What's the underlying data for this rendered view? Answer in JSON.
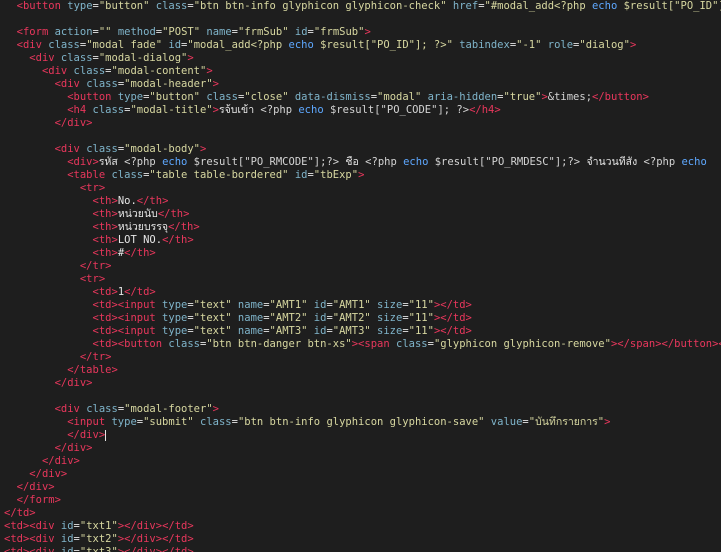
{
  "lines": [
    [
      [
        "  ",
        "t-txt"
      ],
      [
        "<button",
        "t-tag"
      ],
      [
        " type",
        "t-attr"
      ],
      [
        "=",
        "t-txt"
      ],
      [
        "\"button\"",
        "t-str"
      ],
      [
        " class",
        "t-attr"
      ],
      [
        "=",
        "t-txt"
      ],
      [
        "\"btn btn-info glyphicon glyphicon-check\"",
        "t-str"
      ],
      [
        " href",
        "t-attr"
      ],
      [
        "=",
        "t-txt"
      ],
      [
        "\"#modal_add<?php ",
        "t-str"
      ],
      [
        "echo",
        "t-kw"
      ],
      [
        " $result[\"PO_ID\"]; ?>\"",
        "t-str"
      ]
    ],
    [
      [
        "",
        "t-txt"
      ]
    ],
    [
      [
        "  ",
        "t-txt"
      ],
      [
        "<form",
        "t-tag"
      ],
      [
        " action",
        "t-attr"
      ],
      [
        "=",
        "t-txt"
      ],
      [
        "\"\"",
        "t-str"
      ],
      [
        " method",
        "t-attr"
      ],
      [
        "=",
        "t-txt"
      ],
      [
        "\"POST\"",
        "t-str"
      ],
      [
        " name",
        "t-attr"
      ],
      [
        "=",
        "t-txt"
      ],
      [
        "\"frmSub\"",
        "t-str"
      ],
      [
        " id",
        "t-attr"
      ],
      [
        "=",
        "t-txt"
      ],
      [
        "\"frmSub\"",
        "t-str"
      ],
      [
        ">",
        "t-tag"
      ]
    ],
    [
      [
        "  ",
        "t-txt"
      ],
      [
        "<div",
        "t-tag"
      ],
      [
        " class",
        "t-attr"
      ],
      [
        "=",
        "t-txt"
      ],
      [
        "\"modal fade\"",
        "t-str"
      ],
      [
        " id",
        "t-attr"
      ],
      [
        "=",
        "t-txt"
      ],
      [
        "\"modal_add<?php ",
        "t-str"
      ],
      [
        "echo",
        "t-kw"
      ],
      [
        " $result[\"PO_ID\"]; ?>\"",
        "t-str"
      ],
      [
        " tabindex",
        "t-attr"
      ],
      [
        "=",
        "t-txt"
      ],
      [
        "\"-1\"",
        "t-str"
      ],
      [
        " role",
        "t-attr"
      ],
      [
        "=",
        "t-txt"
      ],
      [
        "\"dialog\"",
        "t-str"
      ],
      [
        ">",
        "t-tag"
      ]
    ],
    [
      [
        "    ",
        "t-txt"
      ],
      [
        "<div",
        "t-tag"
      ],
      [
        " class",
        "t-attr"
      ],
      [
        "=",
        "t-txt"
      ],
      [
        "\"modal-dialog\"",
        "t-str"
      ],
      [
        ">",
        "t-tag"
      ]
    ],
    [
      [
        "      ",
        "t-txt"
      ],
      [
        "<div",
        "t-tag"
      ],
      [
        " class",
        "t-attr"
      ],
      [
        "=",
        "t-txt"
      ],
      [
        "\"modal-content\"",
        "t-str"
      ],
      [
        ">",
        "t-tag"
      ]
    ],
    [
      [
        "        ",
        "t-txt"
      ],
      [
        "<div",
        "t-tag"
      ],
      [
        " class",
        "t-attr"
      ],
      [
        "=",
        "t-txt"
      ],
      [
        "\"modal-header\"",
        "t-str"
      ],
      [
        ">",
        "t-tag"
      ]
    ],
    [
      [
        "          ",
        "t-txt"
      ],
      [
        "<button",
        "t-tag"
      ],
      [
        " type",
        "t-attr"
      ],
      [
        "=",
        "t-txt"
      ],
      [
        "\"button\"",
        "t-str"
      ],
      [
        " class",
        "t-attr"
      ],
      [
        "=",
        "t-txt"
      ],
      [
        "\"close\"",
        "t-str"
      ],
      [
        " data-dismiss",
        "t-attr"
      ],
      [
        "=",
        "t-txt"
      ],
      [
        "\"modal\"",
        "t-str"
      ],
      [
        " aria-hidden",
        "t-attr"
      ],
      [
        "=",
        "t-txt"
      ],
      [
        "\"true\"",
        "t-str"
      ],
      [
        ">",
        "t-tag"
      ],
      [
        "&times;",
        "t-ent"
      ],
      [
        "</button>",
        "t-tag"
      ]
    ],
    [
      [
        "          ",
        "t-txt"
      ],
      [
        "<h4",
        "t-tag"
      ],
      [
        " class",
        "t-attr"
      ],
      [
        "=",
        "t-txt"
      ],
      [
        "\"modal-title\"",
        "t-str"
      ],
      [
        ">",
        "t-tag"
      ],
      [
        "รจ้บเข้า ",
        "t-txt"
      ],
      [
        "<?php ",
        "t-php"
      ],
      [
        "echo",
        "t-kw"
      ],
      [
        " $result[\"PO_CODE\"]; ?>",
        "t-php"
      ],
      [
        "</h4>",
        "t-tag"
      ]
    ],
    [
      [
        "        ",
        "t-txt"
      ],
      [
        "</div>",
        "t-tag"
      ]
    ],
    [
      [
        "",
        "t-txt"
      ]
    ],
    [
      [
        "        ",
        "t-txt"
      ],
      [
        "<div",
        "t-tag"
      ],
      [
        " class",
        "t-attr"
      ],
      [
        "=",
        "t-txt"
      ],
      [
        "\"modal-body\"",
        "t-str"
      ],
      [
        ">",
        "t-tag"
      ]
    ],
    [
      [
        "          ",
        "t-txt"
      ],
      [
        "<div>",
        "t-tag"
      ],
      [
        "รหัส ",
        "t-txt"
      ],
      [
        "<?php ",
        "t-php"
      ],
      [
        "echo",
        "t-kw"
      ],
      [
        " $result[\"PO_RMCODE\"];?> ",
        "t-php"
      ],
      [
        "ชื่อ ",
        "t-txt"
      ],
      [
        "<?php ",
        "t-php"
      ],
      [
        "echo",
        "t-kw"
      ],
      [
        " $result[\"PO_RMDESC\"];?> ",
        "t-php"
      ],
      [
        "จำนวนที่สั่ง ",
        "t-txt"
      ],
      [
        "<?php ",
        "t-php"
      ],
      [
        "echo",
        "t-kw"
      ]
    ],
    [
      [
        "          ",
        "t-txt"
      ],
      [
        "<table",
        "t-tag"
      ],
      [
        " class",
        "t-attr"
      ],
      [
        "=",
        "t-txt"
      ],
      [
        "\"table table-bordered\"",
        "t-str"
      ],
      [
        " id",
        "t-attr"
      ],
      [
        "=",
        "t-txt"
      ],
      [
        "\"tbExp\"",
        "t-str"
      ],
      [
        ">",
        "t-tag"
      ]
    ],
    [
      [
        "            ",
        "t-txt"
      ],
      [
        "<tr>",
        "t-tag"
      ]
    ],
    [
      [
        "              ",
        "t-txt"
      ],
      [
        "<th>",
        "t-tag"
      ],
      [
        "No.",
        "t-txt"
      ],
      [
        "</th>",
        "t-tag"
      ]
    ],
    [
      [
        "              ",
        "t-txt"
      ],
      [
        "<th>",
        "t-tag"
      ],
      [
        "หน่วยนับ",
        "t-txt"
      ],
      [
        "</th>",
        "t-tag"
      ]
    ],
    [
      [
        "              ",
        "t-txt"
      ],
      [
        "<th>",
        "t-tag"
      ],
      [
        "หน่วยบรรจุ",
        "t-txt"
      ],
      [
        "</th>",
        "t-tag"
      ]
    ],
    [
      [
        "              ",
        "t-txt"
      ],
      [
        "<th>",
        "t-tag"
      ],
      [
        "LOT NO.",
        "t-txt"
      ],
      [
        "</th>",
        "t-tag"
      ]
    ],
    [
      [
        "              ",
        "t-txt"
      ],
      [
        "<th>",
        "t-tag"
      ],
      [
        "#",
        "t-txt"
      ],
      [
        "</th>",
        "t-tag"
      ]
    ],
    [
      [
        "            ",
        "t-txt"
      ],
      [
        "</tr>",
        "t-tag"
      ]
    ],
    [
      [
        "            ",
        "t-txt"
      ],
      [
        "<tr>",
        "t-tag"
      ]
    ],
    [
      [
        "              ",
        "t-txt"
      ],
      [
        "<td>",
        "t-tag"
      ],
      [
        "1",
        "t-txt"
      ],
      [
        "</td>",
        "t-tag"
      ]
    ],
    [
      [
        "              ",
        "t-txt"
      ],
      [
        "<td><input",
        "t-tag"
      ],
      [
        " type",
        "t-attr"
      ],
      [
        "=",
        "t-txt"
      ],
      [
        "\"text\"",
        "t-str"
      ],
      [
        " name",
        "t-attr"
      ],
      [
        "=",
        "t-txt"
      ],
      [
        "\"AMT1\"",
        "t-str"
      ],
      [
        " id",
        "t-attr"
      ],
      [
        "=",
        "t-txt"
      ],
      [
        "\"AMT1\"",
        "t-str"
      ],
      [
        " size",
        "t-attr"
      ],
      [
        "=",
        "t-txt"
      ],
      [
        "\"11\"",
        "t-str"
      ],
      [
        "></td>",
        "t-tag"
      ]
    ],
    [
      [
        "              ",
        "t-txt"
      ],
      [
        "<td><input",
        "t-tag"
      ],
      [
        " type",
        "t-attr"
      ],
      [
        "=",
        "t-txt"
      ],
      [
        "\"text\"",
        "t-str"
      ],
      [
        " name",
        "t-attr"
      ],
      [
        "=",
        "t-txt"
      ],
      [
        "\"AMT2\"",
        "t-str"
      ],
      [
        " id",
        "t-attr"
      ],
      [
        "=",
        "t-txt"
      ],
      [
        "\"AMT2\"",
        "t-str"
      ],
      [
        " size",
        "t-attr"
      ],
      [
        "=",
        "t-txt"
      ],
      [
        "\"11\"",
        "t-str"
      ],
      [
        "></td>",
        "t-tag"
      ]
    ],
    [
      [
        "              ",
        "t-txt"
      ],
      [
        "<td><input",
        "t-tag"
      ],
      [
        " type",
        "t-attr"
      ],
      [
        "=",
        "t-txt"
      ],
      [
        "\"text\"",
        "t-str"
      ],
      [
        " name",
        "t-attr"
      ],
      [
        "=",
        "t-txt"
      ],
      [
        "\"AMT3\"",
        "t-str"
      ],
      [
        " id",
        "t-attr"
      ],
      [
        "=",
        "t-txt"
      ],
      [
        "\"AMT3\"",
        "t-str"
      ],
      [
        " size",
        "t-attr"
      ],
      [
        "=",
        "t-txt"
      ],
      [
        "\"11\"",
        "t-str"
      ],
      [
        "></td>",
        "t-tag"
      ]
    ],
    [
      [
        "              ",
        "t-txt"
      ],
      [
        "<td><button",
        "t-tag"
      ],
      [
        " class",
        "t-attr"
      ],
      [
        "=",
        "t-txt"
      ],
      [
        "\"btn btn-danger btn-xs\"",
        "t-str"
      ],
      [
        "><span",
        "t-tag"
      ],
      [
        " class",
        "t-attr"
      ],
      [
        "=",
        "t-txt"
      ],
      [
        "\"glyphicon glyphicon-remove\"",
        "t-str"
      ],
      [
        "></span></button></td>",
        "t-tag"
      ]
    ],
    [
      [
        "            ",
        "t-txt"
      ],
      [
        "</tr>",
        "t-tag"
      ]
    ],
    [
      [
        "          ",
        "t-txt"
      ],
      [
        "</table>",
        "t-tag"
      ]
    ],
    [
      [
        "        ",
        "t-txt"
      ],
      [
        "</div>",
        "t-tag"
      ]
    ],
    [
      [
        "",
        "t-txt"
      ]
    ],
    [
      [
        "        ",
        "t-txt"
      ],
      [
        "<div",
        "t-tag"
      ],
      [
        " class",
        "t-attr"
      ],
      [
        "=",
        "t-txt"
      ],
      [
        "\"modal-footer\"",
        "t-str"
      ],
      [
        ">",
        "t-tag"
      ]
    ],
    [
      [
        "          ",
        "t-txt"
      ],
      [
        "<input",
        "t-tag"
      ],
      [
        " type",
        "t-attr"
      ],
      [
        "=",
        "t-txt"
      ],
      [
        "\"submit\"",
        "t-str"
      ],
      [
        " class",
        "t-attr"
      ],
      [
        "=",
        "t-txt"
      ],
      [
        "\"btn btn-info glyphicon glyphicon-save\"",
        "t-str"
      ],
      [
        " value",
        "t-attr"
      ],
      [
        "=",
        "t-txt"
      ],
      [
        "\"บันทึกรายการ\"",
        "t-str"
      ],
      [
        ">",
        "t-tag"
      ]
    ],
    [
      [
        "          ",
        "t-txt"
      ],
      [
        "</div>",
        "t-tag"
      ],
      [
        "",
        "cursor"
      ]
    ],
    [
      [
        "        ",
        "t-txt"
      ],
      [
        "</div>",
        "t-tag"
      ]
    ],
    [
      [
        "      ",
        "t-txt"
      ],
      [
        "</div>",
        "t-tag"
      ]
    ],
    [
      [
        "    ",
        "t-txt"
      ],
      [
        "</div>",
        "t-tag"
      ]
    ],
    [
      [
        "  ",
        "t-txt"
      ],
      [
        "</div>",
        "t-tag"
      ]
    ],
    [
      [
        "  ",
        "t-txt"
      ],
      [
        "</form>",
        "t-tag"
      ]
    ],
    [
      [
        "",
        "t-txt"
      ],
      [
        "</td>",
        "t-tag"
      ]
    ],
    [
      [
        "",
        "t-txt"
      ],
      [
        "<td><div",
        "t-tag"
      ],
      [
        " id",
        "t-attr"
      ],
      [
        "=",
        "t-txt"
      ],
      [
        "\"txt1\"",
        "t-str"
      ],
      [
        "></div></td>",
        "t-tag"
      ]
    ],
    [
      [
        "",
        "t-txt"
      ],
      [
        "<td><div",
        "t-tag"
      ],
      [
        " id",
        "t-attr"
      ],
      [
        "=",
        "t-txt"
      ],
      [
        "\"txt2\"",
        "t-str"
      ],
      [
        "></div></td>",
        "t-tag"
      ]
    ],
    [
      [
        "",
        "t-txt"
      ],
      [
        "<td><div",
        "t-tag"
      ],
      [
        " id",
        "t-attr"
      ],
      [
        "=",
        "t-txt"
      ],
      [
        "\"txt3\"",
        "t-str"
      ],
      [
        "></div></td>",
        "t-tag"
      ]
    ]
  ]
}
